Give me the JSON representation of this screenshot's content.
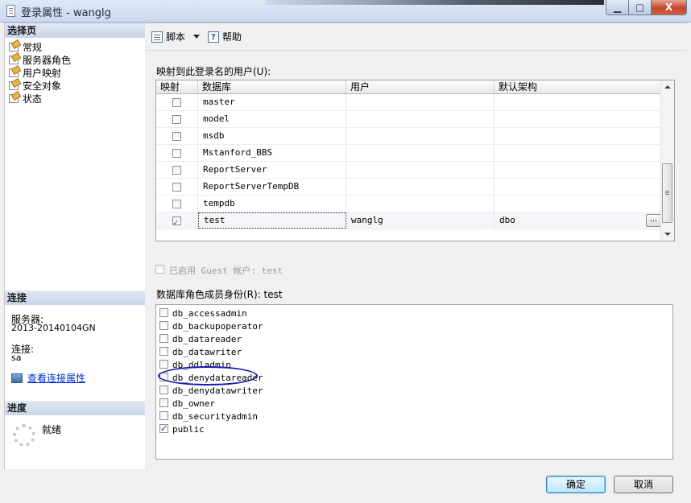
{
  "window": {
    "title": "登录属性 - wanglg",
    "min_label": "▁",
    "max_label": "▢",
    "close_label": "X"
  },
  "left": {
    "select_page_header": "选择页",
    "pages": [
      {
        "label": "常规"
      },
      {
        "label": "服务器角色"
      },
      {
        "label": "用户映射"
      },
      {
        "label": "安全对象"
      },
      {
        "label": "状态"
      }
    ],
    "connection_header": "连接",
    "server_label": "服务器:",
    "server_value": "2013-20140104GN",
    "connection_label": "连接:",
    "connection_value": "sa",
    "view_link": "查看连接属性",
    "progress_header": "进度",
    "progress_status": "就绪"
  },
  "toolbar": {
    "script_label": "脚本",
    "help_label": "帮助"
  },
  "mapping": {
    "label": "映射到此登录名的用户(U):",
    "columns": [
      "映射",
      "数据库",
      "用户",
      "默认架构"
    ],
    "rows": [
      {
        "checked": false,
        "database": "master",
        "user": "",
        "schema": ""
      },
      {
        "checked": false,
        "database": "model",
        "user": "",
        "schema": ""
      },
      {
        "checked": false,
        "database": "msdb",
        "user": "",
        "schema": ""
      },
      {
        "checked": false,
        "database": "Mstanford_BBS",
        "user": "",
        "schema": ""
      },
      {
        "checked": false,
        "database": "ReportServer",
        "user": "",
        "schema": ""
      },
      {
        "checked": false,
        "database": "ReportServerTempDB",
        "user": "",
        "schema": ""
      },
      {
        "checked": false,
        "database": "tempdb",
        "user": "",
        "schema": ""
      },
      {
        "checked": true,
        "database": "test",
        "user": "wanglg",
        "schema": "dbo",
        "selected": true
      }
    ],
    "ellipsis_label": "..."
  },
  "guest": {
    "label": "已启用 Guest 帐户: test",
    "enabled": false
  },
  "roles": {
    "label": "数据库角色成员身份(R): test",
    "items": [
      {
        "name": "db_accessadmin",
        "checked": false
      },
      {
        "name": "db_backupoperator",
        "checked": false
      },
      {
        "name": "db_datareader",
        "checked": false
      },
      {
        "name": "db_datawriter",
        "checked": false
      },
      {
        "name": "db_ddladmin",
        "checked": false
      },
      {
        "name": "db_denydatareader",
        "checked": false,
        "annotated": true
      },
      {
        "name": "db_denydatawriter",
        "checked": false
      },
      {
        "name": "db_owner",
        "checked": false
      },
      {
        "name": "db_securityadmin",
        "checked": false
      },
      {
        "name": "public",
        "checked": true
      }
    ]
  },
  "buttons": {
    "ok": "确定",
    "cancel": "取消"
  },
  "colors": {
    "annotation": "#1b1bb0",
    "link": "#0033cc"
  }
}
